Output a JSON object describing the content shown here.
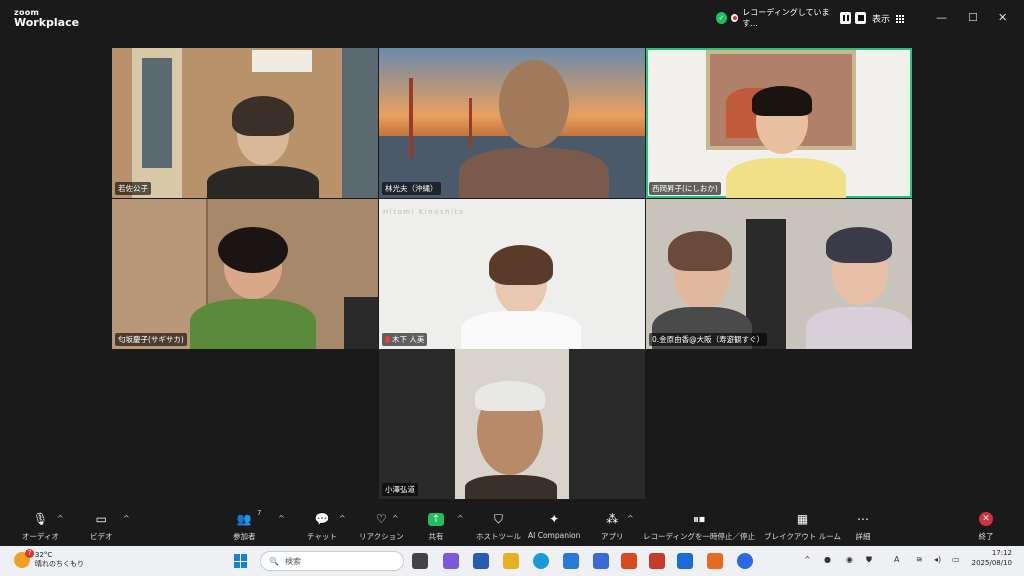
{
  "app": {
    "brand_line1": "zoom",
    "brand_line2": "Workplace"
  },
  "header": {
    "recording_text": "レコーディングしています...",
    "view_label": "表示",
    "window_controls": [
      "—",
      "☐",
      "✕"
    ]
  },
  "participants": [
    {
      "name": "若佐公子",
      "mic_muted": false,
      "active_speaker": false
    },
    {
      "name": "林光夫（沖縄）",
      "mic_muted": false,
      "active_speaker": false
    },
    {
      "name": "西岡昇子(にしおか)",
      "mic_muted": false,
      "active_speaker": true
    },
    {
      "name": "匂坂慶子(サギサカ)",
      "mic_muted": false,
      "active_speaker": false
    },
    {
      "name": "木下 人美",
      "mic_muted": true,
      "active_speaker": false,
      "background_text": "Hitomi Kinoshita"
    },
    {
      "name": "0.金原由香@大阪（寿遊観すぐ）",
      "mic_muted": false,
      "active_speaker": false
    },
    {
      "name": "小澤弘道",
      "mic_muted": false,
      "active_speaker": false
    }
  ],
  "toolbar": {
    "audio": "オーディオ",
    "video": "ビデオ",
    "participants": "参加者",
    "participants_count": "7",
    "chat": "チャット",
    "reactions": "リアクション",
    "share": "共有",
    "host_tools": "ホストツール",
    "ai_companion": "AI Companion",
    "apps": "アプリ",
    "recording_control": "レコーディングを一時停止／停止",
    "breakout": "ブレイクアウト ルーム",
    "more": "詳細",
    "end": "終了"
  },
  "taskbar": {
    "weather_temp": "32°C",
    "weather_desc": "晴れのちくもり",
    "weather_badge": "7",
    "search_placeholder": "検索",
    "time": "17:12",
    "date": "2025/08/10"
  },
  "colors": {
    "speaker_outline": "#27c27e",
    "share_green": "#1fbf5f",
    "end_red": "#d03040"
  }
}
